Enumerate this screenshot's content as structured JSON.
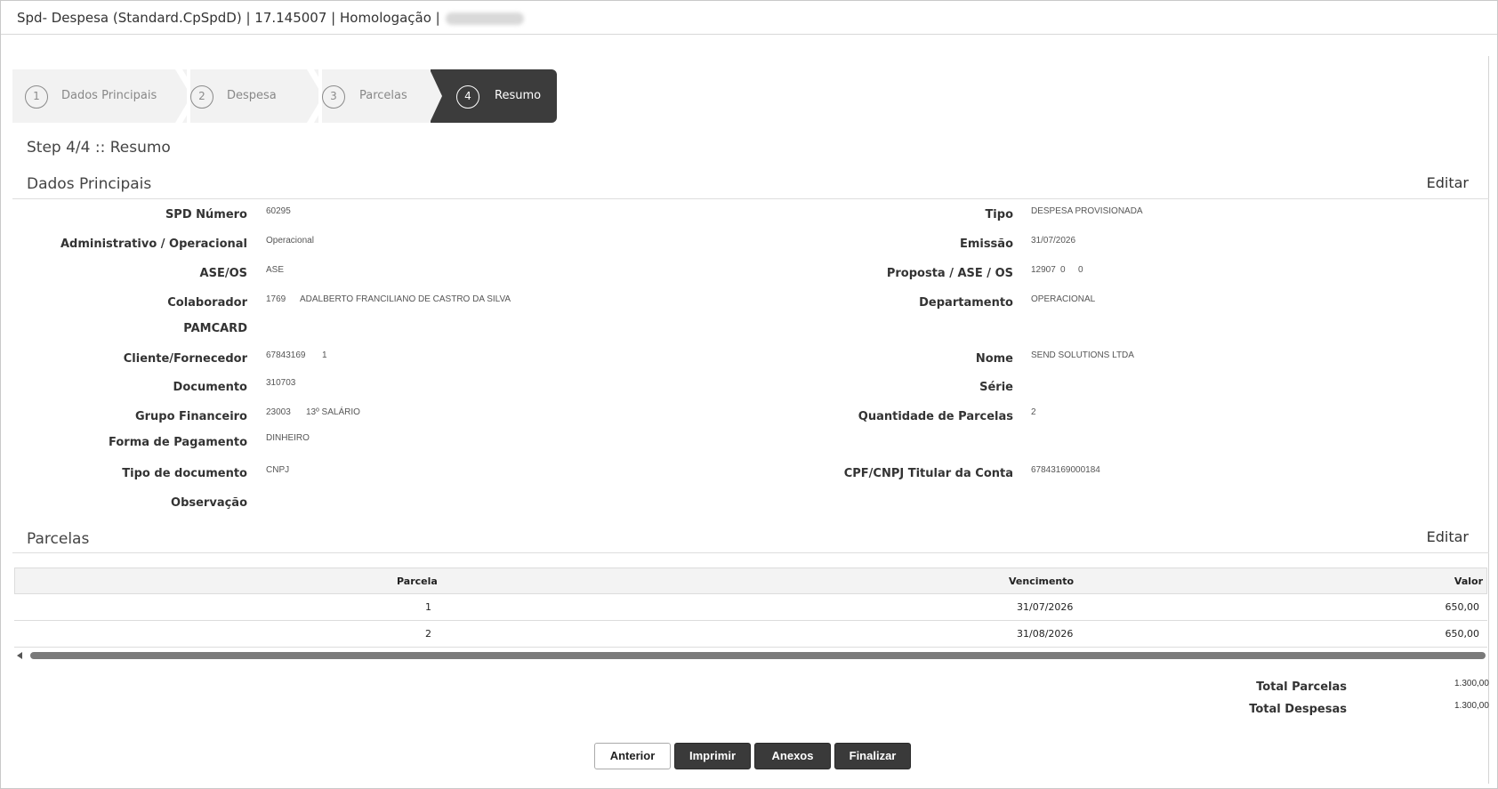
{
  "window": {
    "title": "Spd- Despesa (Standard.CpSpdD) | 17.145007 | Homologação |"
  },
  "wizard": {
    "steps": [
      {
        "num": "1",
        "label": "Dados Principais"
      },
      {
        "num": "2",
        "label": "Despesa"
      },
      {
        "num": "3",
        "label": "Parcelas"
      },
      {
        "num": "4",
        "label": "Resumo"
      }
    ],
    "step_title": "Step 4/4 :: Resumo"
  },
  "dados": {
    "title": "Dados Principais",
    "edit_label": "Editar",
    "spd_label": "SPD Número",
    "spd_value": "60295",
    "tipo_label": "Tipo",
    "tipo_value": "DESPESA PROVISIONADA",
    "admop_label": "Administrativo / Operacional",
    "admop_value": "Operacional",
    "emissao_label": "Emissão",
    "emissao_value": "31/07/2026",
    "aseos_label": "ASE/OS",
    "aseos_value": "ASE",
    "proposta_label": "Proposta / ASE / OS",
    "proposta_v1": "12907",
    "proposta_v2": "0",
    "proposta_v3": "0",
    "colab_label": "Colaborador",
    "colab_code": "1769",
    "colab_name": "ADALBERTO FRANCILIANO DE CASTRO DA SILVA",
    "depto_label": "Departamento",
    "depto_value": "OPERACIONAL",
    "pamcard_label": "PAMCARD",
    "cliente_label": "Cliente/Fornecedor",
    "cliente_code": "67843169",
    "cliente_seq": "1",
    "nome_label": "Nome",
    "nome_value": "SEND SOLUTIONS LTDA",
    "doc_label": "Documento",
    "doc_value": "310703",
    "serie_label": "Série",
    "grupo_label": "Grupo Financeiro",
    "grupo_code": "23003",
    "grupo_name": "13º SALÁRIO",
    "qtd_label": "Quantidade de Parcelas",
    "qtd_value": "2",
    "forma_label": "Forma de Pagamento",
    "forma_value": "DINHEIRO",
    "tipodoc_label": "Tipo de documento",
    "tipodoc_value": "CNPJ",
    "cpf_label": "CPF/CNPJ Titular da Conta",
    "cpf_value": "67843169000184",
    "obs_label": "Observação"
  },
  "parcelas": {
    "title": "Parcelas",
    "edit_label": "Editar",
    "columns": [
      "Parcela",
      "Vencimento",
      "Valor"
    ],
    "rows": [
      [
        "1",
        "31/07/2026",
        "650,00"
      ],
      [
        "2",
        "31/08/2026",
        "650,00"
      ]
    ]
  },
  "totals": {
    "parcelas_label": "Total Parcelas",
    "parcelas_value": "1.300,00",
    "despesas_label": "Total Despesas",
    "despesas_value": "1.300,00"
  },
  "buttons": {
    "anterior": "Anterior",
    "imprimir": "Imprimir",
    "anexos": "Anexos",
    "finalizar": "Finalizar"
  }
}
